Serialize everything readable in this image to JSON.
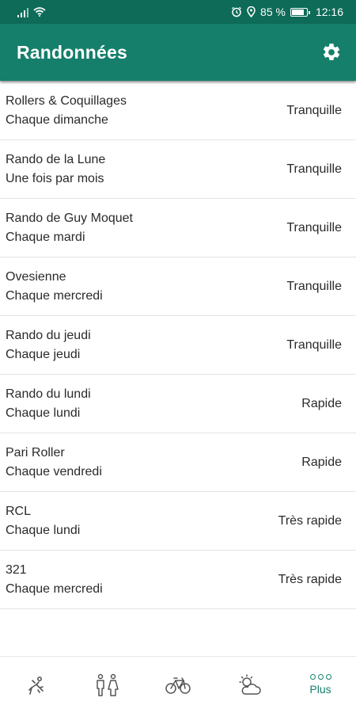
{
  "status_bar": {
    "battery_text": "85 %",
    "time": "12:16"
  },
  "app_bar": {
    "title": "Randonnées"
  },
  "rides": [
    {
      "name": "Rollers & Coquillages",
      "schedule": "Chaque dimanche",
      "pace": "Tranquille"
    },
    {
      "name": "Rando de la Lune",
      "schedule": "Une fois par mois",
      "pace": "Tranquille"
    },
    {
      "name": "Rando de Guy Moquet",
      "schedule": "Chaque mardi",
      "pace": "Tranquille"
    },
    {
      "name": "Ovesienne",
      "schedule": "Chaque mercredi",
      "pace": "Tranquille"
    },
    {
      "name": "Rando du jeudi",
      "schedule": "Chaque jeudi",
      "pace": "Tranquille"
    },
    {
      "name": "Rando du lundi",
      "schedule": "Chaque lundi",
      "pace": "Rapide"
    },
    {
      "name": "Pari Roller",
      "schedule": "Chaque vendredi",
      "pace": "Rapide"
    },
    {
      "name": "RCL",
      "schedule": "Chaque lundi",
      "pace": "Très rapide"
    },
    {
      "name": "321",
      "schedule": "Chaque mercredi",
      "pace": "Très rapide"
    }
  ],
  "bottom_nav": {
    "items": [
      {
        "icon": "skater-icon",
        "label": ""
      },
      {
        "icon": "people-icon",
        "label": ""
      },
      {
        "icon": "bicycle-icon",
        "label": ""
      },
      {
        "icon": "weather-icon",
        "label": ""
      },
      {
        "icon": "more-icon",
        "label": "Plus"
      }
    ],
    "active_index": 4
  },
  "colors": {
    "status_bar": "#0d6b58",
    "app_bar": "#157f6b",
    "accent": "#157f6b"
  }
}
